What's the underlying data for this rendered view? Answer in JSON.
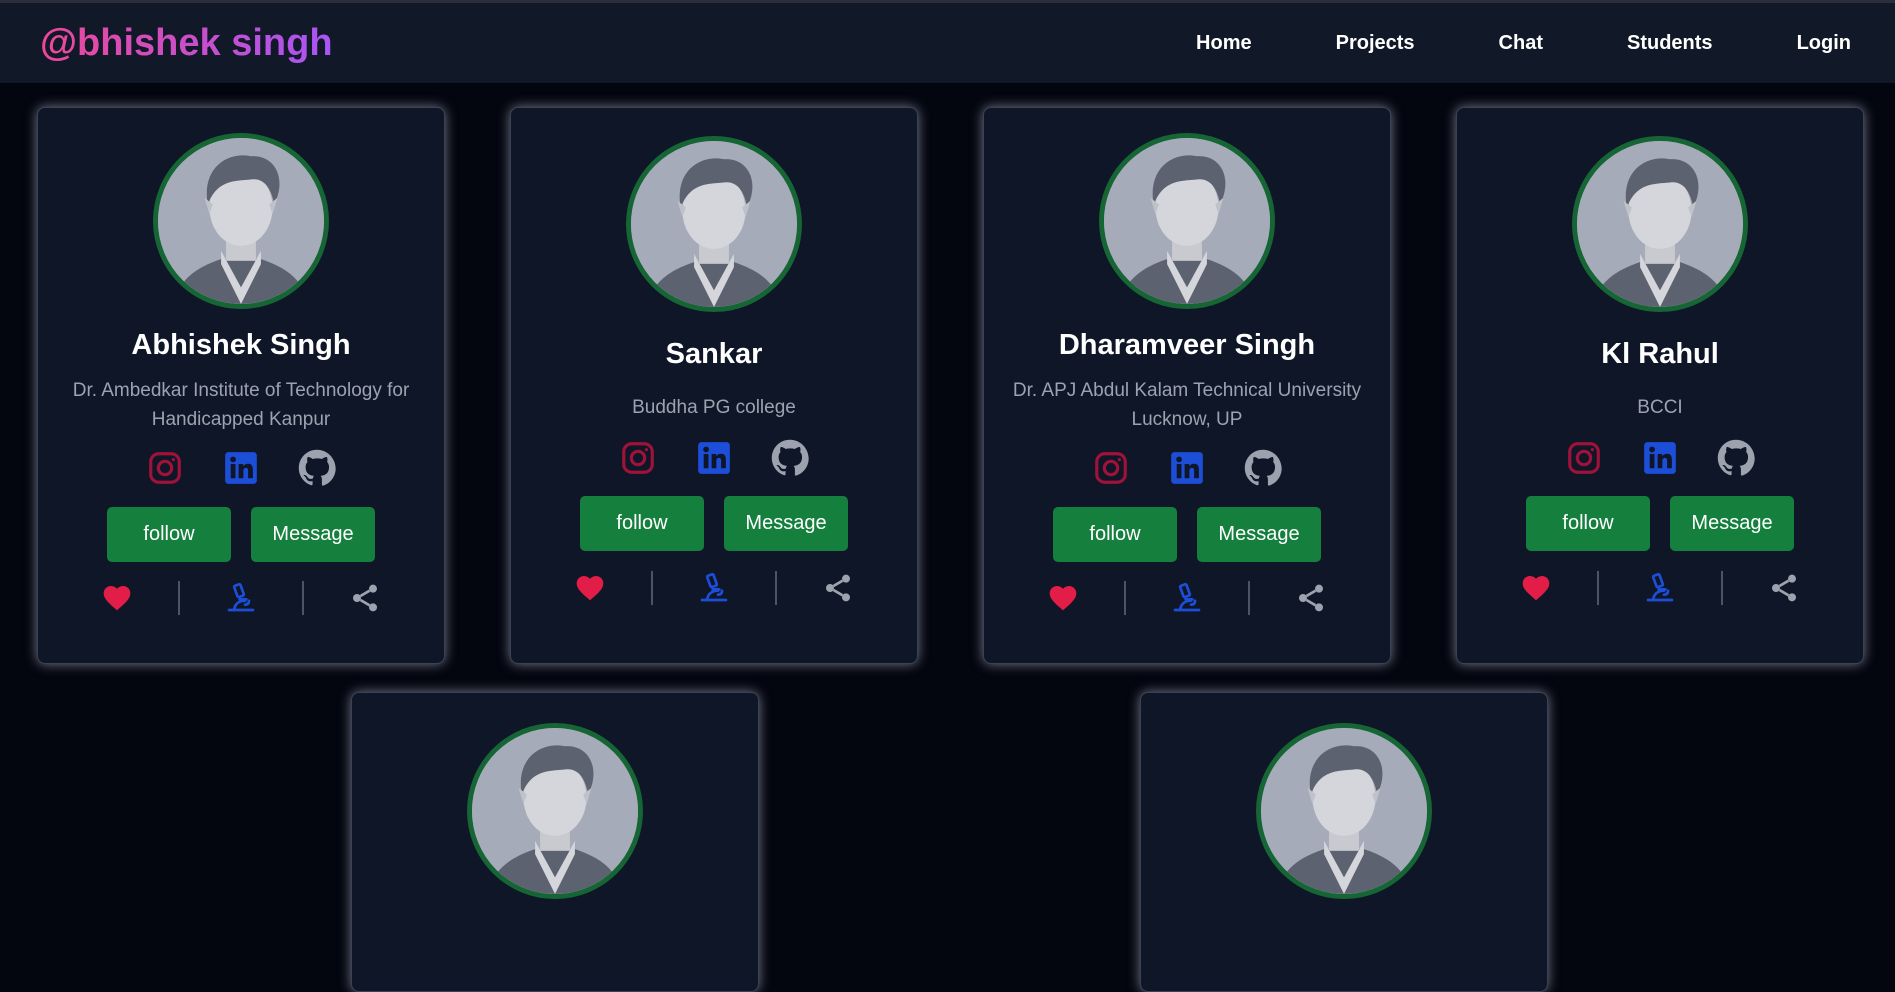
{
  "navbar": {
    "brand": "@bhishek singh",
    "links": [
      "Home",
      "Projects",
      "Chat",
      "Students",
      "Login"
    ]
  },
  "cards": [
    {
      "name": "Abhishek Singh",
      "college": "Dr. Ambedkar Institute of Technology for Handicapped Kanpur",
      "follow": "follow",
      "message": "Message"
    },
    {
      "name": "Sankar",
      "college": "Buddha PG college",
      "follow": "follow",
      "message": "Message"
    },
    {
      "name": "Dharamveer Singh",
      "college": "Dr. APJ Abdul Kalam Technical University Lucknow, UP",
      "follow": "follow",
      "message": "Message"
    },
    {
      "name": "Kl Rahul",
      "college": "BCCI",
      "follow": "follow",
      "message": "Message"
    }
  ],
  "icons": {
    "social": [
      "instagram-icon",
      "linkedin-icon",
      "github-icon"
    ],
    "bottom": [
      "heart-icon",
      "microscope-icon",
      "share-icon"
    ]
  },
  "colors": {
    "background": "#03050f",
    "navbar": "#111827",
    "card": "#0f1627",
    "brand_gradient": [
      "#ec4899",
      "#a855f7"
    ],
    "button": "#15803d",
    "avatar_ring": "#166534",
    "instagram": "#9f1239",
    "linkedin": "#1d4ed8",
    "github": "#9ca3af",
    "heart": "#e11d48",
    "microscope": "#1d4ed8",
    "share": "#9ca3af"
  }
}
